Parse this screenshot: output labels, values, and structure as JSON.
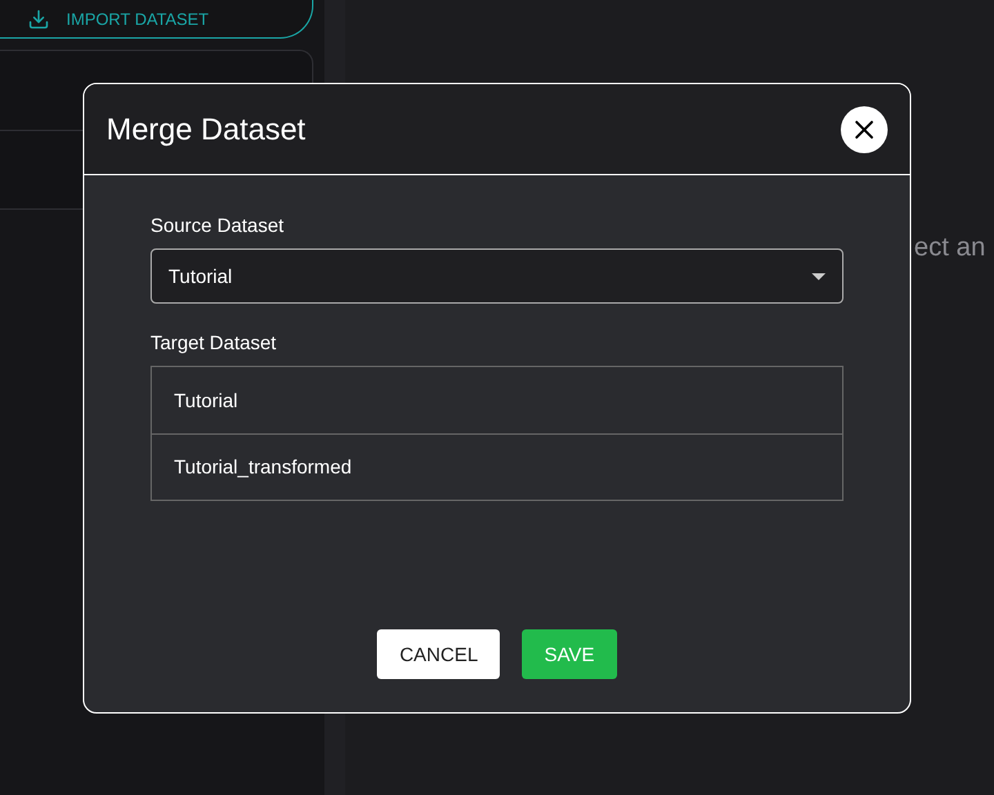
{
  "sidebar": {
    "import_button": "IMPORT DATASET"
  },
  "main": {
    "hint": "ect an"
  },
  "dialog": {
    "title": "Merge Dataset",
    "source_label": "Source Dataset",
    "source_value": "Tutorial",
    "target_label": "Target Dataset",
    "targets": [
      {
        "label": "Tutorial"
      },
      {
        "label": "Tutorial_transformed"
      }
    ],
    "buttons": [
      {
        "label": "CANCEL",
        "kind": "secondary"
      },
      {
        "label": "SAVE",
        "kind": "primary"
      }
    ]
  }
}
